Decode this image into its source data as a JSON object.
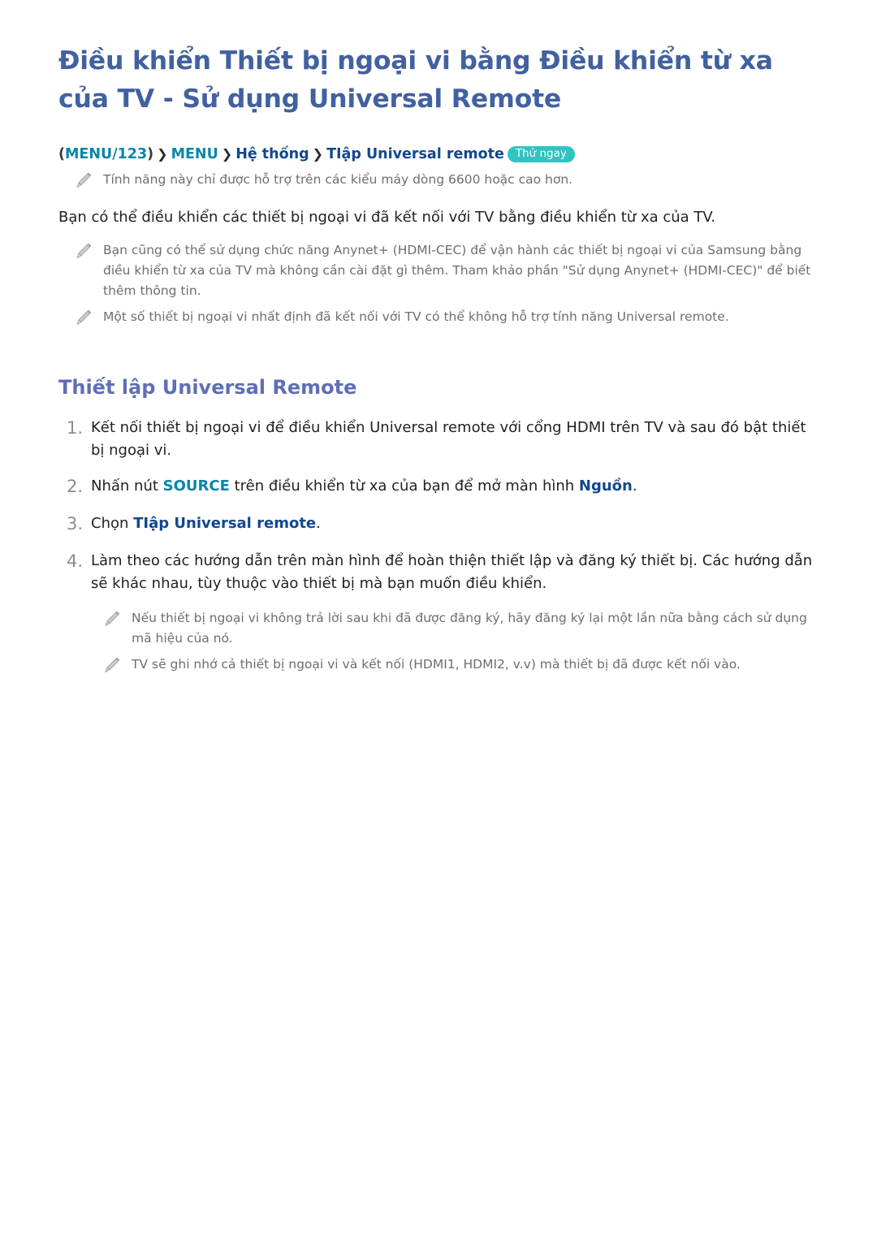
{
  "document": {
    "title": "Điều khiển Thiết bị ngoại vi bằng Điều khiển từ xa của TV - Sử dụng Universal Remote",
    "menu_path": {
      "open_paren": "(",
      "key_1": "MENU/123",
      "close_paren": ")",
      "separator": "❯",
      "key_2": "MENU",
      "item_1": "Hệ thống",
      "item_2": "TIập Universal remote",
      "badge": "Thử ngay"
    },
    "top_note": "Tính năng này chỉ được hỗ trợ trên các kiểu máy dòng 6600 hoặc cao hơn.",
    "intro_paragraph": "Bạn có thể điều khiển các thiết bị ngoại vi đã kết nối với TV bằng điều khiển từ xa của TV.",
    "intro_notes": [
      "Bạn cũng có thể sử dụng chức năng Anynet+ (HDMI-CEC) để vận hành các thiết bị ngoại vi của Samsung bằng điều khiển từ xa của TV mà không cần cài đặt gì thêm. Tham khảo phần \"Sử dụng Anynet+ (HDMI-CEC)\" để biết thêm thông tin.",
      "Một số thiết bị ngoại vi nhất định đã kết nối với TV có thể không hỗ trợ tính năng Universal remote."
    ],
    "section": {
      "heading": "Thiết lập Universal Remote",
      "steps": [
        {
          "number": "1.",
          "text_before": "Kết nối thiết bị ngoại vi để điều khiển Universal remote với cổng HDMI trên TV và sau đó bật thiết bị ngoại vi.",
          "keyword_teal": "",
          "text_middle": "",
          "keyword_navy": "",
          "text_after": ""
        },
        {
          "number": "2.",
          "text_before": "Nhấn nút ",
          "keyword_teal": "SOURCE",
          "text_middle": " trên điều khiển từ xa của bạn để mở màn hình ",
          "keyword_navy": "Nguồn",
          "text_after": "."
        },
        {
          "number": "3.",
          "text_before": "Chọn ",
          "keyword_teal": "",
          "text_middle": "",
          "keyword_navy": "TIập Universal remote",
          "text_after": "."
        },
        {
          "number": "4.",
          "text_before": "Làm theo các hướng dẫn trên màn hình để hoàn thiện thiết lập và đăng ký thiết bị. Các hướng dẫn sẽ khác nhau, tùy thuộc vào thiết bị mà bạn muốn điều khiển.",
          "keyword_teal": "",
          "text_middle": "",
          "keyword_navy": "",
          "text_after": ""
        }
      ],
      "step_notes": [
        "Nếu thiết bị ngoại vi không trả lời sau khi đã được đăng ký, hãy đăng ký lại một lần nữa bằng cách sử dụng mã hiệu của nó.",
        "TV sẽ ghi nhớ cả thiết bị ngoại vi và kết nối (HDMI1, HDMI2, v.v) mà thiết bị đã được kết nối vào."
      ]
    },
    "icons": {
      "note_bullet": "pencil-icon"
    },
    "colors": {
      "title": "#41619f",
      "section_heading": "#5f6fb5",
      "menu_key": "#0b86a8",
      "menu_item": "#12478f",
      "badge_bg": "#2fc4c0",
      "note_text": "#6d6e71",
      "body_text": "#231f20",
      "step_number": "#8a8c8e"
    }
  }
}
